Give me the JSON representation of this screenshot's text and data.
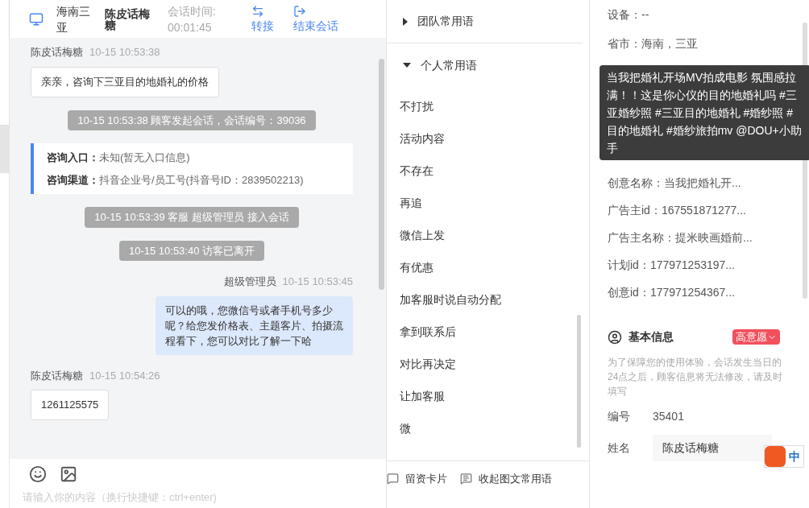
{
  "header": {
    "location": "海南三亚",
    "customer": "陈皮话梅糖",
    "duration_label": "会话时间:",
    "duration": "00:01:45",
    "actions": [
      {
        "kind": "transfer",
        "label": "转接"
      },
      {
        "kind": "end",
        "label": "结束会话"
      }
    ]
  },
  "messages": [
    {
      "kind": "incoming",
      "sender": "陈皮话梅糖",
      "time": "10-15 10:53:38",
      "text": "亲亲，咨询下三亚目的地婚礼的价格"
    },
    {
      "kind": "system",
      "text": "10-15 10:53:38 顾客发起会话，会话编号：39036"
    },
    {
      "kind": "info",
      "lines": [
        {
          "label": "咨询入口：",
          "value": "未知(暂无入口信息)"
        },
        {
          "label": "咨询渠道：",
          "value": "抖音企业号/员工号(抖音号ID：2839502213)"
        }
      ]
    },
    {
      "kind": "system",
      "text": "10-15 10:53:39 客服 超级管理员 接入会话"
    },
    {
      "kind": "system",
      "text": "10-15 10:53:40 访客已离开"
    },
    {
      "kind": "outgoing",
      "sender": "超级管理员",
      "time": "10-15 10:53:45",
      "text": "可以的哦，您微信号或者手机号多少呢？给您发价格表、主题客片、拍摄流程看下，您可以对比了解一下哈"
    },
    {
      "kind": "incoming",
      "sender": "陈皮话梅糖",
      "time": "10-15 10:54:26",
      "text": "1261125575"
    }
  ],
  "input": {
    "placeholder": "请输入你的内容（换行快捷键：ctrl+enter)"
  },
  "phrases": {
    "groups": [
      {
        "label": "团队常用语",
        "expanded": false
      },
      {
        "label": "个人常用语",
        "expanded": true
      }
    ],
    "items": [
      "不打扰",
      "活动内容",
      "不存在",
      "再追",
      "微信上发",
      "有优惠",
      "加客服时说自动分配",
      "拿到联系后",
      "对比再决定",
      "让加客服",
      "微"
    ],
    "footer": [
      {
        "kind": "card",
        "label": "留资卡片"
      },
      {
        "kind": "collapse",
        "label": "收起图文常用语"
      }
    ]
  },
  "details": {
    "top_rows": [
      "设备：--",
      "省市：海南，三亚"
    ],
    "tooltip": "当我把婚礼开场MV拍成电影 氛围感拉满！！这是你心仪的目的地婚礼吗 #三亚婚纱照 #三亚目的地婚礼 #婚纱照 #目的地婚礼 #婚纱旅拍mv @DOU+小助手",
    "rows": [
      "创意名称：当我把婚礼开...",
      "广告主id：167551871277...",
      "广告主名称：提米映画婚前...",
      "计划id：177971253197...",
      "创意id：177971254367..."
    ],
    "basic": {
      "title": "基本信息",
      "tag": "高意愿",
      "note": "为了保障您的使用体验，会话发生当日的24点之后，顾客信息将无法修改，请及时填写",
      "fields": [
        {
          "kind": "text",
          "label": "编号",
          "value": "35401"
        },
        {
          "kind": "input",
          "label": "姓名",
          "value": "陈皮话梅糖"
        }
      ]
    },
    "ime": "中"
  }
}
